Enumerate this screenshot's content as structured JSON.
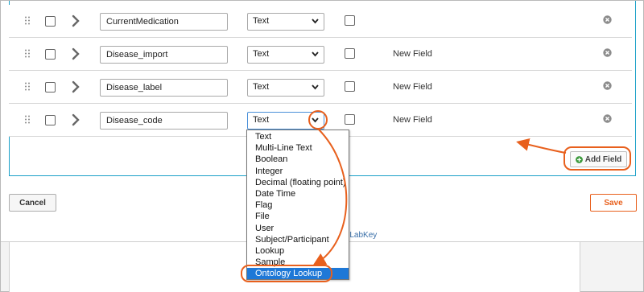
{
  "fields": [
    {
      "name": "CurrentMedication",
      "type": "Text",
      "label": ""
    },
    {
      "name": "Disease_import",
      "type": "Text",
      "label": "New Field"
    },
    {
      "name": "Disease_label",
      "type": "Text",
      "label": "New Field"
    },
    {
      "name": "Disease_code",
      "type": "Text",
      "label": "New Field"
    }
  ],
  "type_options": [
    "Text",
    "Multi-Line Text",
    "Boolean",
    "Integer",
    "Decimal (floating point)",
    "Date Time",
    "Flag",
    "File",
    "User",
    "Subject/Participant",
    "Lookup",
    "Sample",
    "Ontology Lookup"
  ],
  "selected_type_option": "Ontology Lookup",
  "buttons": {
    "add_field": "Add Field",
    "cancel": "Cancel",
    "save": "Save"
  },
  "footer": {
    "powered_by": "by LabKey"
  },
  "colors": {
    "accent": "#e8601d",
    "panel_border": "#1aa0c8",
    "selection": "#1e78d7",
    "add_icon": "#3c9a3c"
  }
}
